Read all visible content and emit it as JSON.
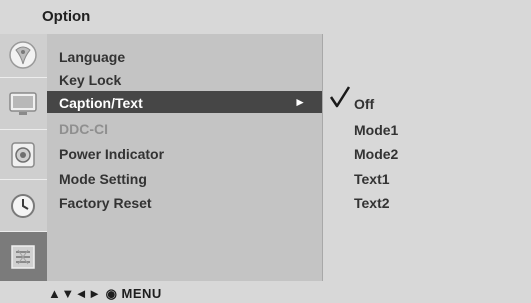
{
  "header": {
    "title": "Option"
  },
  "sidebar": {
    "icons": [
      {
        "name": "satellite-dish-icon",
        "active": false
      },
      {
        "name": "picture-icon",
        "active": false
      },
      {
        "name": "speaker-icon",
        "active": false
      },
      {
        "name": "clock-icon",
        "active": false
      },
      {
        "name": "option-settings-icon",
        "active": true
      }
    ]
  },
  "menu": {
    "items": [
      {
        "label": "Language",
        "state": "normal"
      },
      {
        "label": "Key Lock",
        "state": "normal"
      },
      {
        "label": "Caption/Text",
        "state": "selected"
      },
      {
        "label": "DDC-CI",
        "state": "disabled"
      },
      {
        "label": "Power Indicator",
        "state": "normal"
      },
      {
        "label": "Mode Setting",
        "state": "normal"
      },
      {
        "label": "Factory Reset",
        "state": "normal"
      }
    ],
    "submenu_arrow": "►"
  },
  "submenu": {
    "options": [
      "Off",
      "Mode1",
      "Mode2",
      "Text1",
      "Text2"
    ],
    "selected": "Off",
    "check_glyph": "√"
  },
  "footer": {
    "nav_hint": "▲▼◄► ◉ MENU"
  },
  "colors": {
    "selected_bg": "#464646",
    "menu_bg": "#c4c4c4",
    "header_bg": "#d8d8d8",
    "disabled_text": "#8f8f8f"
  }
}
